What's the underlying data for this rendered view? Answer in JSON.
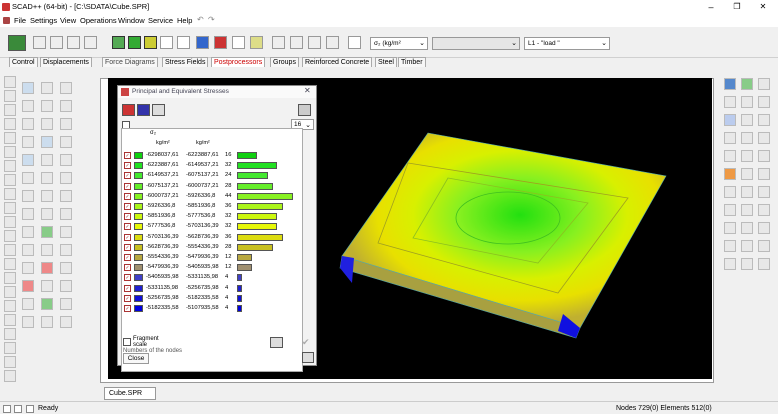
{
  "window": {
    "title": "SCAD++ (64-bit) - [C:\\SDATA\\Cube.SPR]",
    "min": "–",
    "restore": "❐",
    "close": "✕"
  },
  "menu": [
    "File",
    "Settings",
    "View",
    "Operations",
    "Window",
    "Service",
    "Help"
  ],
  "toolbar": {
    "units_combo": "σ₂ (kg/m²",
    "empty_combo": "",
    "load_combo": "L1 - \"load \""
  },
  "tabs": [
    "Control",
    "Displacements",
    "Force Diagrams",
    "Stress Fields",
    "Postprocessors",
    "Groups",
    "Reinforced Concrete",
    "Steel",
    "Timber"
  ],
  "panel": {
    "title": "Principal and Equivalent Stresses",
    "count_value": "16",
    "param_label": "σ₂",
    "col1_header": "kg/m²",
    "col2_header": "kg/m²",
    "rows": [
      {
        "from": "-6298037,61",
        "to": "-6223887,61",
        "pct": "16",
        "color": "#10d010",
        "bar": 0.36
      },
      {
        "from": "-6223887,61",
        "to": "-6149537,21",
        "pct": "32",
        "color": "#22e022",
        "bar": 0.72
      },
      {
        "from": "-6149537,21",
        "to": "-6075137,21",
        "pct": "24",
        "color": "#44e830",
        "bar": 0.55
      },
      {
        "from": "-6075137,21",
        "to": "-6000737,21",
        "pct": "28",
        "color": "#66ee2a",
        "bar": 0.64
      },
      {
        "from": "-6000737,21",
        "to": "-5926336,8",
        "pct": "44",
        "color": "#88f222",
        "bar": 1.0
      },
      {
        "from": "-5926336,8",
        "to": "-5851936,8",
        "pct": "36",
        "color": "#aaf51a",
        "bar": 0.82
      },
      {
        "from": "-5851936,8",
        "to": "-5777536,8",
        "pct": "32",
        "color": "#ccf80e",
        "bar": 0.72
      },
      {
        "from": "-5777536,8",
        "to": "-5703136,39",
        "pct": "32",
        "color": "#e6f808",
        "bar": 0.72
      },
      {
        "from": "-5703136,39",
        "to": "-5628736,39",
        "pct": "36",
        "color": "#dcdc10",
        "bar": 0.82
      },
      {
        "from": "-5628736,39",
        "to": "-5554336,39",
        "pct": "28",
        "color": "#c8c020",
        "bar": 0.64
      },
      {
        "from": "-5554336,39",
        "to": "-5479936,39",
        "pct": "12",
        "color": "#b8a840",
        "bar": 0.27
      },
      {
        "from": "-5479936,39",
        "to": "-5405935,98",
        "pct": "12",
        "color": "#a09070",
        "bar": 0.27
      },
      {
        "from": "-5405935,98",
        "to": "-5331135,98",
        "pct": "4",
        "color": "#4040c8",
        "bar": 0.09
      },
      {
        "from": "-5331135,98",
        "to": "-5256735,98",
        "pct": "4",
        "color": "#2020d0",
        "bar": 0.09
      },
      {
        "from": "-5256735,98",
        "to": "-5182335,58",
        "pct": "4",
        "color": "#1010d8",
        "bar": 0.09
      },
      {
        "from": "-5182335,58",
        "to": "-5107935,58",
        "pct": "4",
        "color": "#0000e0",
        "bar": 0.09
      }
    ],
    "fragment_label": "Fragment scale",
    "numbers_label": "Numbers of the nodes",
    "close_label": "Close"
  },
  "document_tab": "Cube.SPR",
  "status": {
    "ready": "Ready",
    "nodes": "Nodes 729(0) Elements 512(0)"
  }
}
